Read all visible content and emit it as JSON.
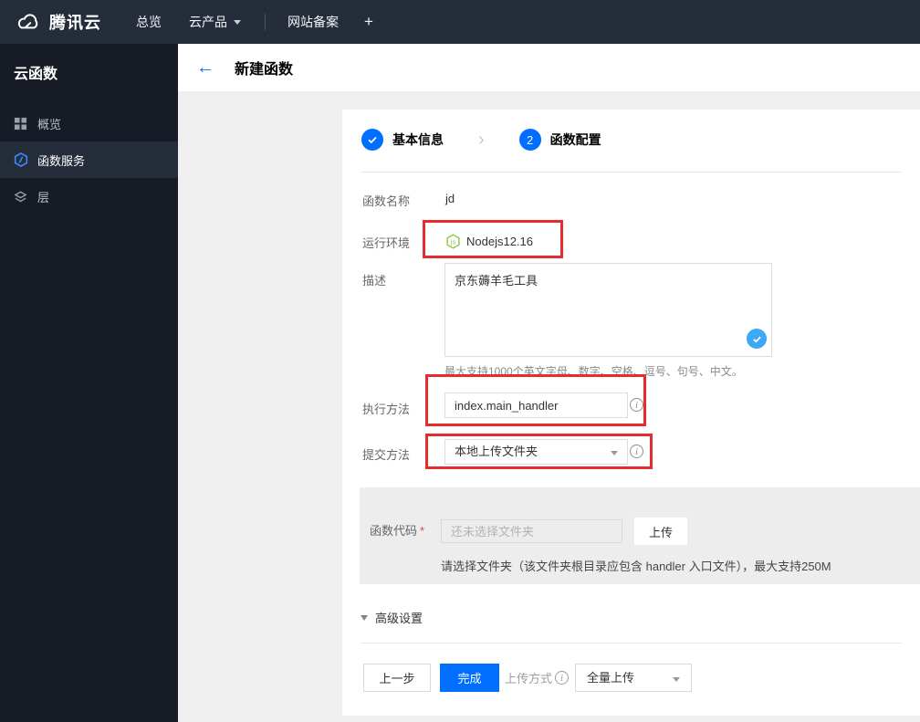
{
  "topbar": {
    "brand": "腾讯云",
    "nav_overview": "总览",
    "nav_products": "云产品",
    "nav_beian": "网站备案",
    "nav_add": "+"
  },
  "sidebar": {
    "title": "云函数",
    "items": [
      {
        "label": "概览",
        "icon": "grid-icon",
        "active": false
      },
      {
        "label": "函数服务",
        "icon": "scf-hexagon-icon",
        "active": true
      },
      {
        "label": "层",
        "icon": "layers-icon",
        "active": false
      }
    ]
  },
  "header": {
    "title": "新建函数"
  },
  "steps": {
    "step1_label": "基本信息",
    "step1_state": "done",
    "step2_number": "2",
    "step2_label": "函数配置"
  },
  "form": {
    "name_label": "函数名称",
    "name_value": "jd",
    "runtime_label": "运行环境",
    "runtime_value": "Nodejs12.16",
    "desc_label": "描述",
    "desc_value": "京东薅羊毛工具",
    "desc_hint": "最大支持1000个英文字母、数字、空格、逗号、句号、中文。",
    "handler_label": "执行方法",
    "handler_value": "index.main_handler",
    "submit_label": "提交方法",
    "submit_value": "本地上传文件夹",
    "code_label": "函数代码",
    "code_required": "*",
    "code_placeholder": "还未选择文件夹",
    "upload_button": "上传",
    "code_hint": "请选择文件夹（该文件夹根目录应包含 handler 入口文件），最大支持250M",
    "advanced_label": "高级设置"
  },
  "footer": {
    "prev_button": "上一步",
    "finish_button": "完成",
    "upload_mode_label": "上传方式",
    "upload_mode_value": "全量上传"
  },
  "glyphs": {
    "back_arrow": "←",
    "info": "i",
    "step_chevron": "›"
  },
  "colors": {
    "accent_blue": "#006eff",
    "annotation_red": "#e62c2c",
    "node_green": "#8cc84b",
    "check_blue": "#3da8f5",
    "topbar_bg": "#252d3b",
    "sidebar_bg": "#161b25"
  }
}
